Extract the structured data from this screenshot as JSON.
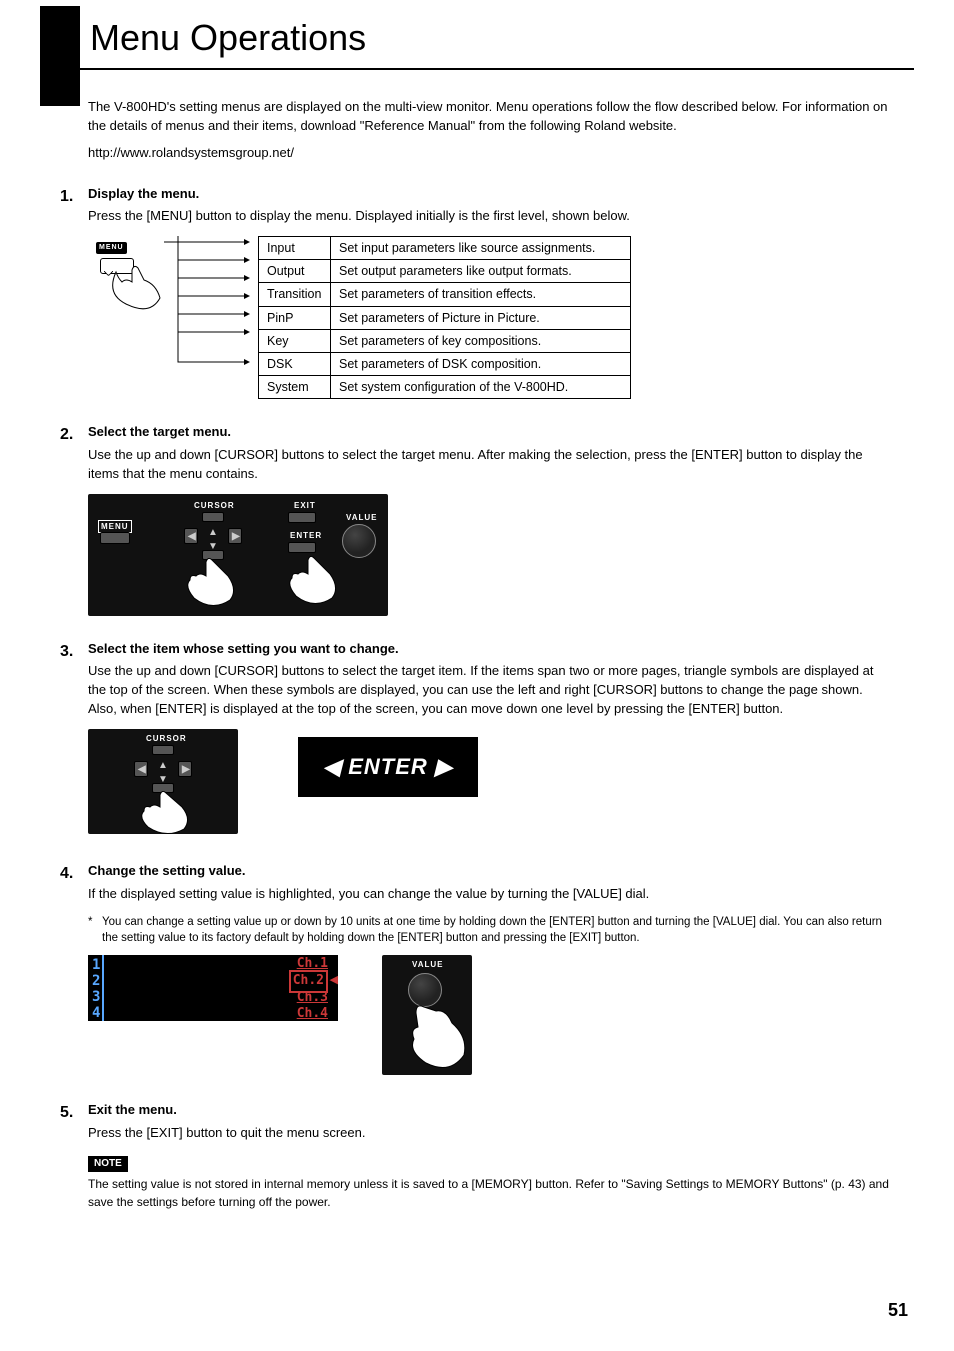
{
  "title": "Menu Operations",
  "intro": "The V-800HD's setting menus are displayed on the multi-view monitor. Menu operations follow the flow described below. For information on the details of menus and their items, download \"Reference Manual\" from the following Roland website.",
  "url": "http://www.rolandsystemsgroup.net/",
  "steps": {
    "s1": {
      "num": "1.",
      "head": "Display the menu.",
      "text": "Press the [MENU] button to display the menu. Displayed initially is the first level, shown below.",
      "button_label": "MENU",
      "rows": [
        {
          "cat": "Input",
          "desc": "Set input parameters like source assignments."
        },
        {
          "cat": "Output",
          "desc": "Set output parameters like output formats."
        },
        {
          "cat": "Transition",
          "desc": "Set parameters of transition effects."
        },
        {
          "cat": "PinP",
          "desc": "Set parameters of Picture in Picture."
        },
        {
          "cat": "Key",
          "desc": "Set parameters of key compositions."
        },
        {
          "cat": "DSK",
          "desc": "Set parameters of DSK composition."
        },
        {
          "cat": "System",
          "desc": "Set system configuration of the V-800HD."
        }
      ]
    },
    "s2": {
      "num": "2.",
      "head": "Select the target menu.",
      "text": "Use the up and down [CURSOR] buttons to select the target menu. After making the selection, press the [ENTER] button to display the items that the menu contains.",
      "panel": {
        "menu": "MENU",
        "cursor": "CURSOR",
        "exit": "EXIT",
        "enter": "ENTER",
        "value": "VALUE"
      }
    },
    "s3": {
      "num": "3.",
      "head": "Select the item whose setting you want to change.",
      "text": "Use the up and down [CURSOR] buttons to select the target item. If the items span two or more pages, triangle symbols are displayed at the top of the screen. When these symbols are displayed, you can use the left and right [CURSOR] buttons to change the page shown. Also, when [ENTER] is displayed at the top of the screen, you can move down one level by pressing the [ENTER] button.",
      "cursor_label": "CURSOR",
      "screen_label": "ENTER"
    },
    "s4": {
      "num": "4.",
      "head": "Change the setting value.",
      "text": "If the displayed setting value is highlighted, you can change the value by turning the [VALUE] dial.",
      "note": "You can change a setting value up or down by 10 units at one time by holding down the [ENTER] button and turning the [VALUE] dial. You can also return the setting value to its factory default by holding down the [ENTER] button and pressing the [EXIT] button.",
      "value_label": "VALUE",
      "nums": [
        "1",
        "2",
        "3",
        "4"
      ],
      "chs": [
        "Ch.1",
        "Ch.2",
        "Ch.3",
        "Ch.4"
      ]
    },
    "s5": {
      "num": "5.",
      "head": "Exit the menu.",
      "text": "Press the [EXIT] button to quit the menu screen.",
      "note_label": "NOTE",
      "note_text": "The setting value is not stored in internal memory unless it is saved to a [MEMORY] button. Refer to \"Saving Settings to MEMORY Buttons\" (p. 43) and save the settings before turning off the power."
    }
  },
  "page_num": "51"
}
